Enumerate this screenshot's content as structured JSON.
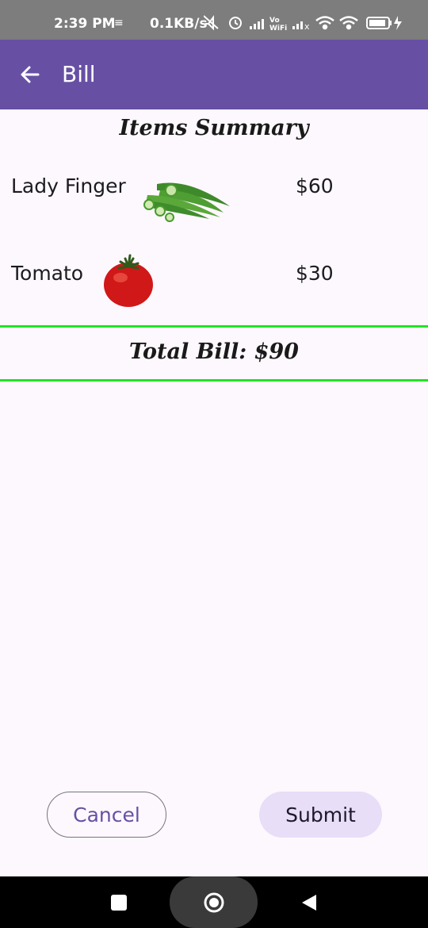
{
  "status_bar": {
    "time": "2:39 PM",
    "sim_icon": "sim-icon",
    "net_speed": "0.1KB/s",
    "icons": [
      "mute-icon",
      "alarm-icon",
      "signal-icon",
      "vowifi-icon",
      "signal-x-icon",
      "wifi-icon",
      "hotspot-icon",
      "battery-icon",
      "charging-icon"
    ]
  },
  "app_bar": {
    "back_icon": "arrow-back-icon",
    "title": "Bill"
  },
  "summary": {
    "title": "Items Summary",
    "items": [
      {
        "name": "Lady Finger",
        "price": "$60",
        "image": "okra-image"
      },
      {
        "name": "Tomato",
        "price": "$30",
        "image": "tomato-image"
      }
    ],
    "total": "Total Bill: $90"
  },
  "actions": {
    "cancel_label": "Cancel",
    "submit_label": "Submit"
  },
  "nav_bar": {
    "icons": [
      "recents-icon",
      "home-icon",
      "back-icon"
    ]
  },
  "colors": {
    "status_bar": "#7d7d7d",
    "app_bar": "#6750a4",
    "divider": "#22e322",
    "submit_bg": "#e8def8",
    "background": "#fdf8fd"
  }
}
